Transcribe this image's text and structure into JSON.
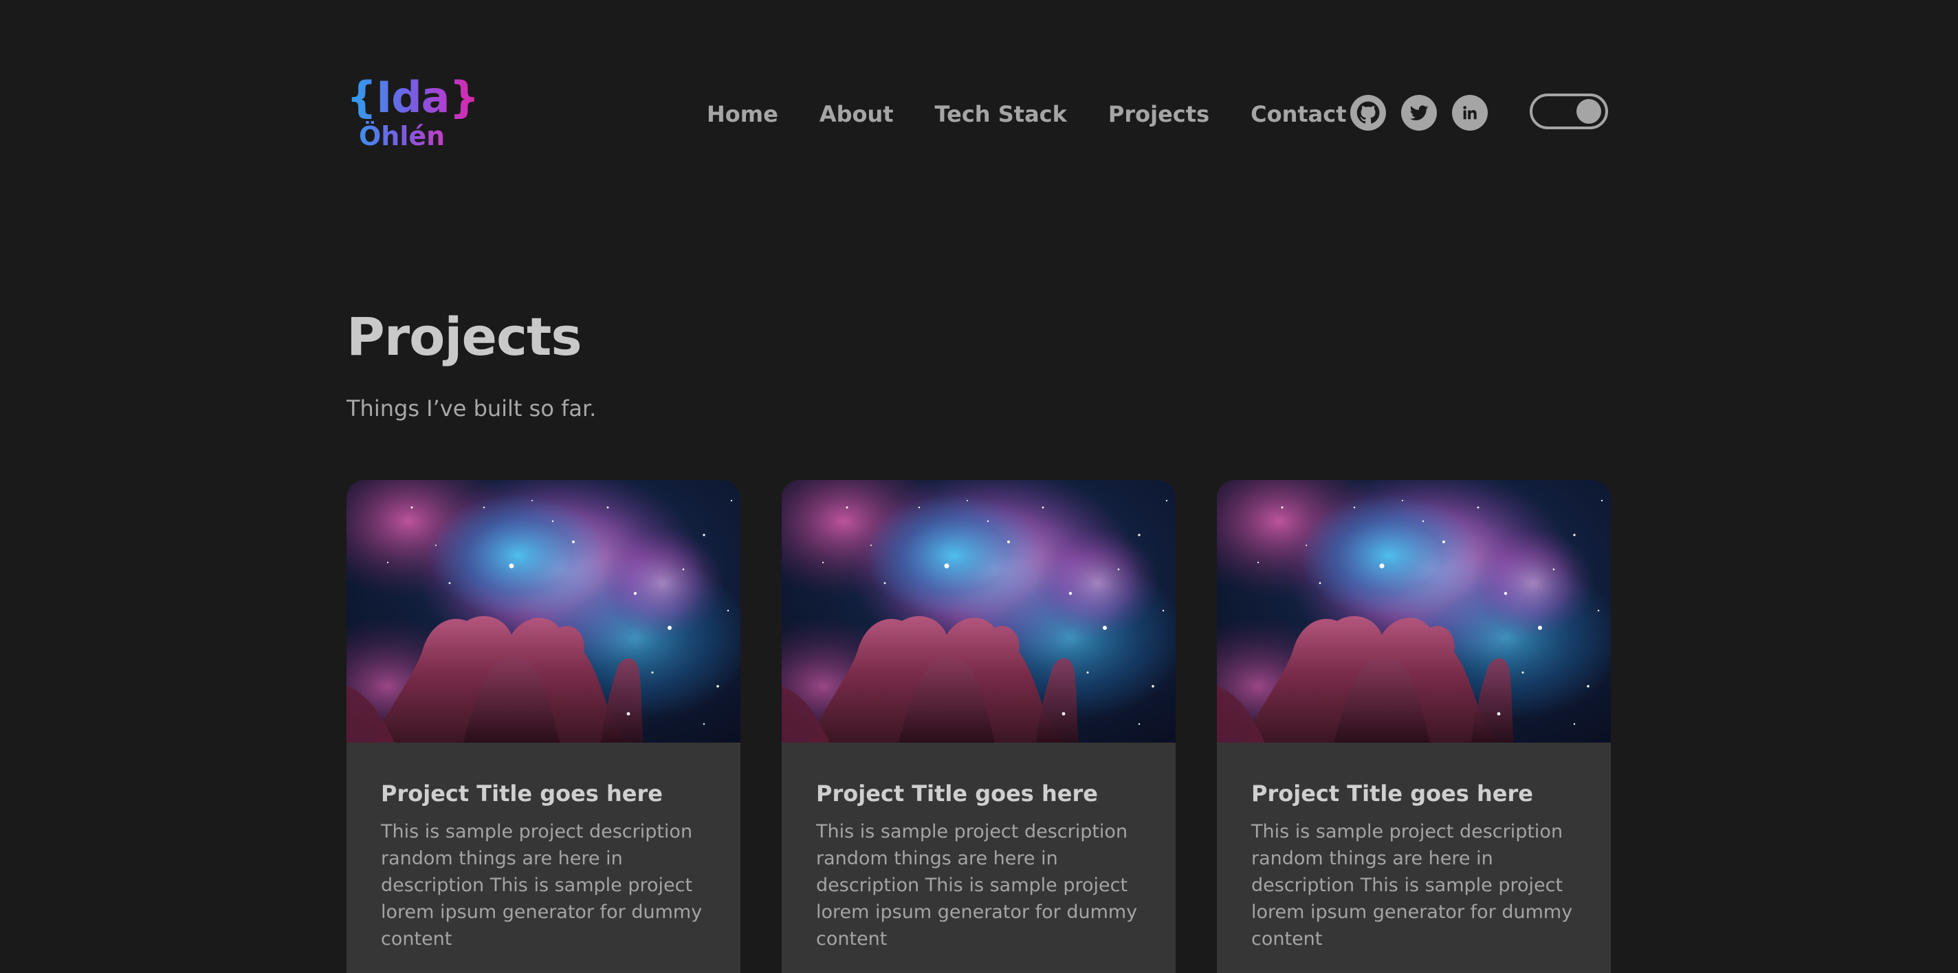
{
  "logo": {
    "top": "{Ida}",
    "bottom": "Öhlén"
  },
  "nav": {
    "items": [
      {
        "label": "Home"
      },
      {
        "label": "About"
      },
      {
        "label": "Tech Stack"
      },
      {
        "label": "Projects"
      },
      {
        "label": "Contact"
      }
    ]
  },
  "social": {
    "icons": [
      "github-icon",
      "twitter-icon",
      "linkedin-icon"
    ]
  },
  "theme_toggle": {
    "state": "on"
  },
  "section": {
    "title": "Projects",
    "subtitle": "Things I’ve built so far."
  },
  "projects": [
    {
      "title": "Project Title goes here",
      "description": "This is sample project description random things are here in description This is sample project lorem ipsum generator for dummy content",
      "image": "nebula-image"
    },
    {
      "title": "Project Title goes here",
      "description": "This is sample project description random things are here in description This is sample project lorem ipsum generator for dummy content",
      "image": "nebula-image"
    },
    {
      "title": "Project Title goes here",
      "description": "This is sample project description random things are here in description This is sample project lorem ipsum generator for dummy content",
      "image": "nebula-image"
    }
  ],
  "colors": {
    "background": "#1a1a1a",
    "card": "#363636",
    "text_muted": "#a5a5a5",
    "heading": "#c9c9c9",
    "logo_gradient_start": "#2aa3ec",
    "logo_gradient_end": "#e0249f"
  }
}
